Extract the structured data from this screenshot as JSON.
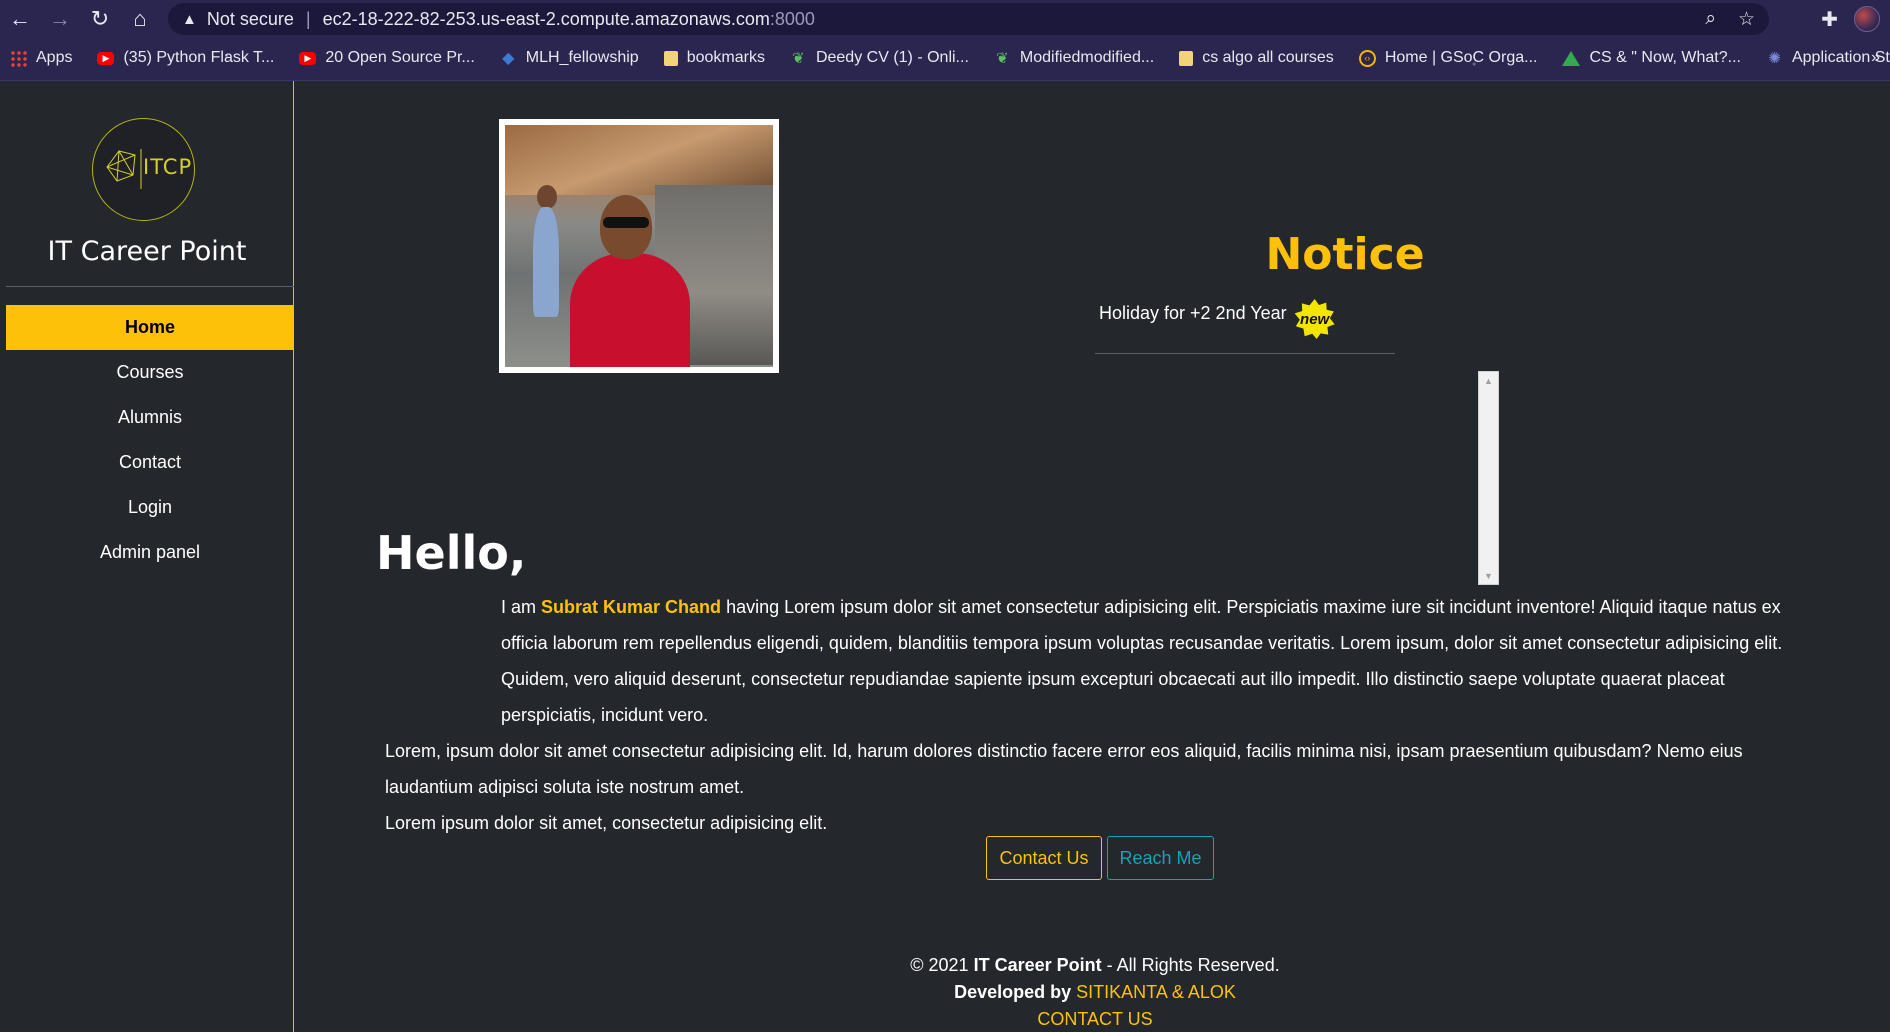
{
  "browser": {
    "security_label": "Not secure",
    "url_host": "ec2-18-222-82-253.us-east-2.compute.amazonaws.com",
    "url_port": ":8000",
    "bookmarks": [
      {
        "label": "Apps",
        "icon": "apps-grid-icon"
      },
      {
        "label": "(35) Python Flask T...",
        "icon": "youtube-icon"
      },
      {
        "label": "20 Open Source Pr...",
        "icon": "youtube-icon"
      },
      {
        "label": "MLH_fellowship",
        "icon": "mlh-icon"
      },
      {
        "label": "bookmarks",
        "icon": "folder-icon"
      },
      {
        "label": "Deedy CV (1) - Onli...",
        "icon": "overleaf-icon"
      },
      {
        "label": "Modifiedmodified...",
        "icon": "overleaf-icon"
      },
      {
        "label": "cs algo all courses",
        "icon": "folder-icon"
      },
      {
        "label": "Home | GSoC Orga...",
        "icon": "gsoc-icon"
      },
      {
        "label": "CS & \" Now, What?...",
        "icon": "drive-icon"
      },
      {
        "label": "Application Status",
        "icon": "app-status-icon"
      }
    ],
    "more_bookmarks": "»"
  },
  "sidebar": {
    "logo_text": "ITCP",
    "brand": "IT Career Point",
    "nav": [
      {
        "label": "Home",
        "active": true
      },
      {
        "label": "Courses",
        "active": false
      },
      {
        "label": "Alumnis",
        "active": false
      },
      {
        "label": "Contact",
        "active": false
      },
      {
        "label": "Login",
        "active": false
      },
      {
        "label": "Admin panel",
        "active": false
      }
    ]
  },
  "notice": {
    "title": "Notice",
    "items": [
      {
        "text": "Holiday for +2 2nd Year",
        "badge": "new"
      }
    ]
  },
  "intro": {
    "greeting": "Hello,",
    "lead": "I am",
    "name": "Subrat Kumar Chand",
    "paragraph1": "having Lorem ipsum dolor sit amet consectetur adipisicing elit. Perspiciatis maxime iure sit incidunt inventore! Aliquid itaque natus ex officia laborum rem repellendus eligendi, quidem, blanditiis tempora ipsum voluptas recusandae veritatis. Lorem ipsum, dolor sit amet consectetur adipisicing elit. Quidem, vero aliquid deserunt, consectetur repudiandae sapiente ipsum excepturi obcaecati aut illo impedit. Illo distinctio saepe voluptate quaerat placeat perspiciatis, incidunt vero.",
    "paragraph2": "Lorem, ipsum dolor sit amet consectetur adipisicing elit. Id, harum dolores distinctio facere error eos aliquid, facilis minima nisi, ipsam praesentium quibusdam? Nemo eius laudantium adipisci soluta iste nostrum amet.",
    "paragraph3": "Lorem ipsum dolor sit amet, consectetur adipisicing elit."
  },
  "buttons": {
    "contact": "Contact Us",
    "reach": "Reach Me"
  },
  "footer": {
    "copyright_prefix": "© 2021",
    "site_name": "IT Career Point",
    "rights": "- All Rights Reserved.",
    "developed_by": "Developed by",
    "developers": "SITIKANTA & ALOK",
    "contact_link": "CONTACT US"
  },
  "colors": {
    "accent": "#fec10a",
    "info": "#17a2b8",
    "background": "#24272c"
  }
}
